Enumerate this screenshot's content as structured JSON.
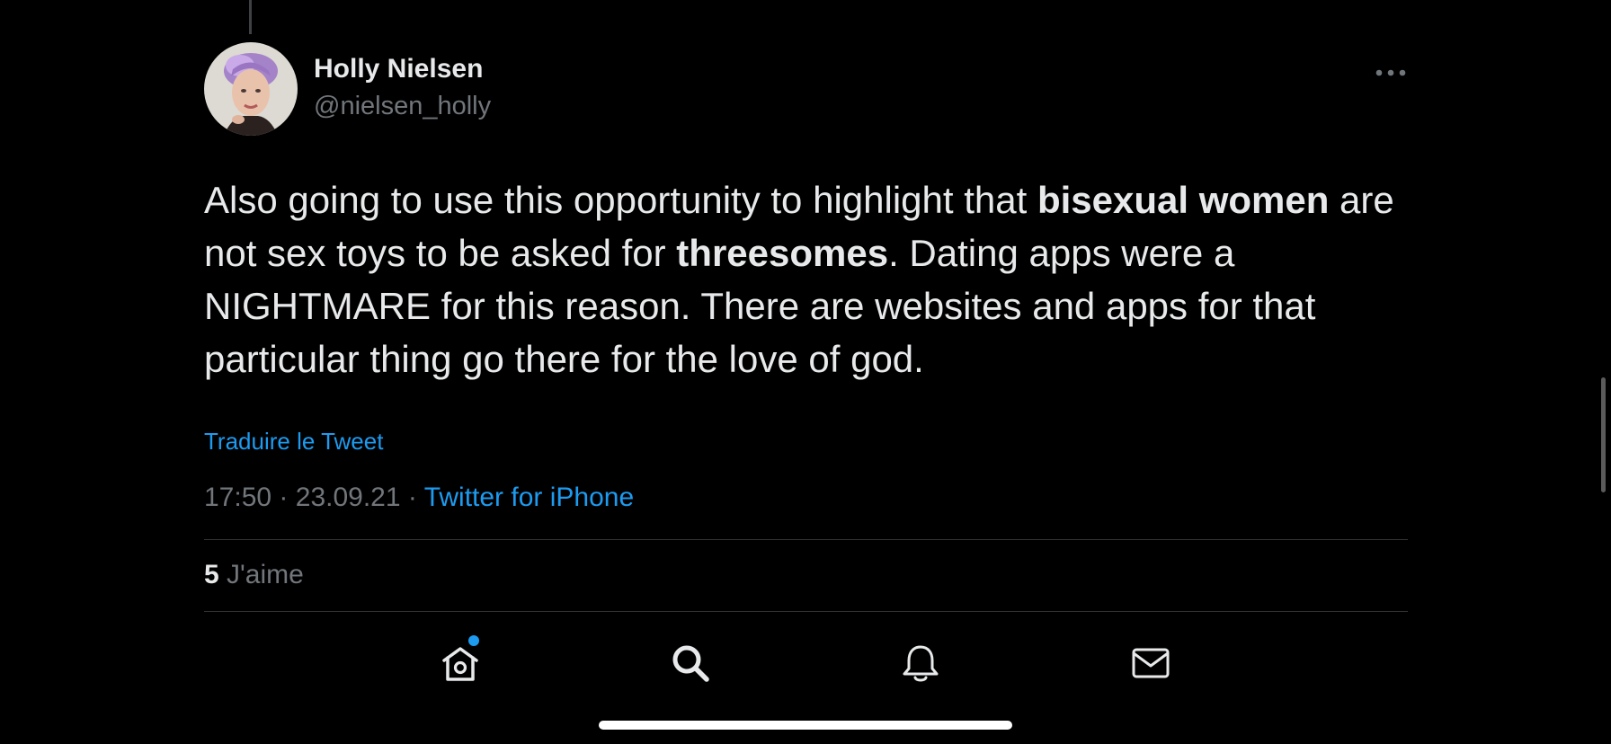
{
  "tweet": {
    "author": {
      "display_name": "Holly Nielsen",
      "handle": "@nielsen_holly"
    },
    "text_segments": [
      "Also going to use this opportunity to highlight that ",
      "bisexual women",
      " are not sex toys to be asked for ",
      "threesomes",
      ". Dating apps were a NIGHTMARE for this reason. There are websites and apps for that particular thing go there for the love of god."
    ],
    "translate_label": "Traduire le Tweet",
    "time": "17:50",
    "separator": "·",
    "date": "23.09.21",
    "source": "Twitter for iPhone",
    "likes_count": "5",
    "likes_label": "J'aime"
  },
  "tab_bar": {
    "items": [
      {
        "icon": "home-icon",
        "has_notification_dot": true
      },
      {
        "icon": "search-icon"
      },
      {
        "icon": "bell-icon"
      },
      {
        "icon": "mail-icon"
      }
    ]
  },
  "colors": {
    "background": "#000000",
    "text_primary": "#e7e9ea",
    "text_secondary": "#71767b",
    "accent": "#1d9bf0",
    "divider": "#2f3336"
  }
}
